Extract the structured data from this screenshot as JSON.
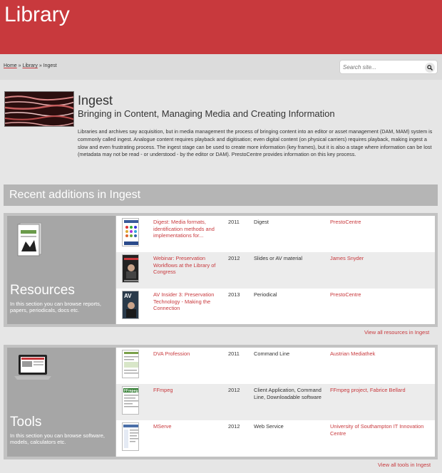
{
  "header": {
    "site_title": "Library"
  },
  "breadcrumb": {
    "home": "Home",
    "sep1": " » ",
    "library": "Library",
    "sep2": " » ",
    "current": "Ingest"
  },
  "search": {
    "placeholder": "Search site..."
  },
  "page": {
    "title": "Ingest",
    "subtitle": "Bringing in Content, Managing Media and Creating Information",
    "intro": "Libraries and archives say acquisition, but in media management the process of bringing content into an editor or asset management (DAM, MAM) system is commonly called ingest.  Analogue content requires playback and digitisation; even digital content (on physical carriers) requires playback, making ingest a slow and even frustrating process. The ingest stage can be used to create more information (key frames), but it is also a stage where information can be lost (metadata may not be read - or understood - by the editor or DAM). PrestoCentre provides information on this key process."
  },
  "recent": {
    "heading": "Recent additions in Ingest"
  },
  "resources": {
    "title": "Resources",
    "desc": "In this section you can browse reports, papers, periodicals, docs etc.",
    "view_all": "View all resources in Ingest",
    "rows": [
      {
        "title": "Digest: Media formats, identification methods and implementations for...",
        "year": "2011",
        "type": "Digest",
        "publisher": "PrestoCentre"
      },
      {
        "title": "Webinar: Preservation Workflows at the Library of Congress",
        "year": "2012",
        "type": "Slides or AV material",
        "publisher": "James Snyder"
      },
      {
        "title": "AV Insider 3: Preservation Technology - Making the Connection",
        "year": "2013",
        "type": "Periodical",
        "publisher": "PrestoCentre"
      }
    ]
  },
  "tools": {
    "title": "Tools",
    "desc": "In this section you can browse software, models, calculators etc.",
    "view_all": "View all tools in Ingest",
    "rows": [
      {
        "title": "DVA Profession",
        "year": "2011",
        "type": "Command Line",
        "publisher": "Austrian Mediathek"
      },
      {
        "title": "FFmpeg",
        "year": "2012",
        "type": "Client Application, Command Line, Downloadable software",
        "publisher": "FFmpeg project, Fabrice Bellard"
      },
      {
        "title": "MServe",
        "year": "2012",
        "type": "Web Service",
        "publisher": "University of Southampton IT Innovation Centre"
      }
    ]
  },
  "thumb_labels": {
    "av_insider": "AV",
    "ffmpeg": "FFmpeg"
  },
  "colors": {
    "brand_red": "#c8393d",
    "panel_grey": "#c2c2c2"
  },
  "icons": {
    "search": "search-icon"
  }
}
